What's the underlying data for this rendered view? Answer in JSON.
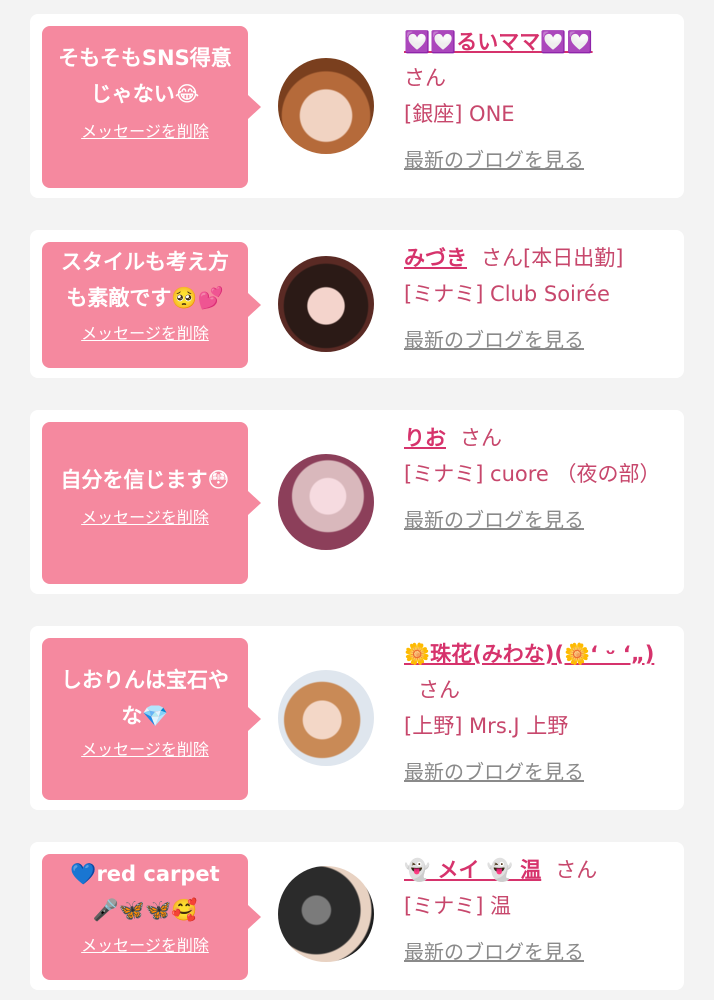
{
  "delete_label": "メッセージを削除",
  "blog_label": "最新のブログを見る",
  "san_label": "さん",
  "colors": {
    "bubble": "#f5899f",
    "name": "#d6336c",
    "info": "#c7476c",
    "link_gray": "#8a8a8a",
    "background": "#f3f3f3"
  },
  "messages": [
    {
      "bubble_line1": "そもそもSNS得意",
      "bubble_line2": "じゃない😂",
      "name": "💟💟るいママ💟💟",
      "suffix": "",
      "shop": "[銀座] ONE"
    },
    {
      "bubble_line1": "スタイルも考え方",
      "bubble_line2": "も素敵です🥺💕",
      "name": "みづき",
      "suffix": "[本日出勤]",
      "shop": "[ミナミ] Club Soirée"
    },
    {
      "bubble_line1": "自分を信じます😳",
      "bubble_line2": "",
      "name": "りお",
      "suffix": "",
      "shop": "[ミナミ] cuore （夜の部）"
    },
    {
      "bubble_line1": "しおりんは宝石や",
      "bubble_line2": "な💎",
      "name": "🌼珠花(みわな)(🌼‘ ᵕ ‘„)",
      "suffix": "",
      "shop": "[上野] Mrs.J 上野"
    },
    {
      "bubble_line1": "💙red carpet",
      "bubble_line2": "🎤🦋🦋🥰",
      "name": "👻 メイ 👻 温",
      "suffix": "",
      "shop": "[ミナミ] 温"
    }
  ]
}
